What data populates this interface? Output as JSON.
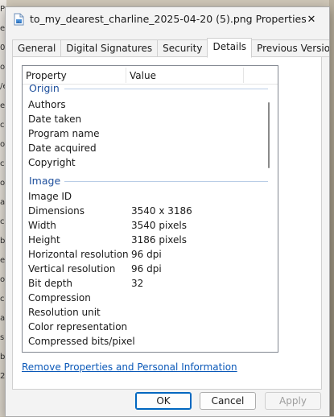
{
  "window": {
    "title": "to_my_dearest_charline_2025-04-20 (5).png Properties",
    "close_glyph": "✕"
  },
  "background": {
    "left_fragments": [
      "P",
      "ec",
      "0",
      "o",
      "/e",
      "e",
      "cu",
      "o",
      "co",
      "o",
      "a",
      "cu",
      "b",
      "e",
      "o",
      "cu",
      "a",
      "s",
      "b",
      "2"
    ]
  },
  "tabs": [
    {
      "label": "General",
      "active": false
    },
    {
      "label": "Digital Signatures",
      "active": false
    },
    {
      "label": "Security",
      "active": false
    },
    {
      "label": "Details",
      "active": true
    },
    {
      "label": "Previous Versions",
      "active": false
    }
  ],
  "list": {
    "columns": {
      "property": "Property",
      "value": "Value"
    },
    "groups": [
      {
        "name": "Origin",
        "rows": [
          {
            "name": "Authors",
            "value": ""
          },
          {
            "name": "Date taken",
            "value": ""
          },
          {
            "name": "Program name",
            "value": ""
          },
          {
            "name": "Date acquired",
            "value": ""
          },
          {
            "name": "Copyright",
            "value": ""
          }
        ]
      },
      {
        "name": "Image",
        "rows": [
          {
            "name": "Image ID",
            "value": ""
          },
          {
            "name": "Dimensions",
            "value": "3540 x 3186"
          },
          {
            "name": "Width",
            "value": "3540 pixels"
          },
          {
            "name": "Height",
            "value": "3186 pixels"
          },
          {
            "name": "Horizontal resolution",
            "value": "96 dpi"
          },
          {
            "name": "Vertical resolution",
            "value": "96 dpi"
          },
          {
            "name": "Bit depth",
            "value": "32"
          },
          {
            "name": "Compression",
            "value": ""
          },
          {
            "name": "Resolution unit",
            "value": ""
          },
          {
            "name": "Color representation",
            "value": ""
          },
          {
            "name": "Compressed bits/pixel",
            "value": ""
          }
        ]
      }
    ]
  },
  "link": {
    "label": "Remove Properties and Personal Information"
  },
  "buttons": {
    "ok": "OK",
    "cancel": "Cancel",
    "apply": "Apply"
  },
  "colors": {
    "accent": "#0067c0",
    "group_header": "#1e4f9c",
    "link": "#0a58b8"
  }
}
